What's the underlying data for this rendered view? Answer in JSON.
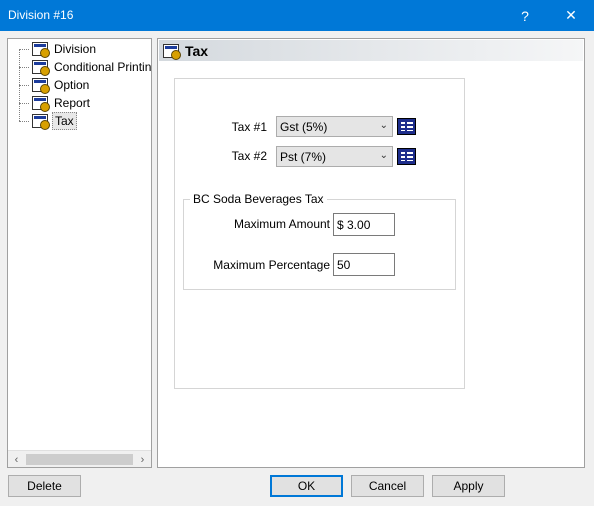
{
  "window": {
    "title": "Division #16",
    "help": "?",
    "close": "✕"
  },
  "tree": {
    "items": [
      {
        "label": "Division"
      },
      {
        "label": "Conditional Printin"
      },
      {
        "label": "Option"
      },
      {
        "label": "Report"
      },
      {
        "label": "Tax"
      }
    ],
    "selected": "Tax",
    "scroll_left": "‹",
    "scroll_right": "›"
  },
  "panel": {
    "title": "Tax",
    "tax1": {
      "label": "Tax #1",
      "value": "Gst (5%)"
    },
    "tax2": {
      "label": "Tax #2",
      "value": "Pst (7%)"
    },
    "group": {
      "title": "BC Soda Beverages Tax",
      "max_amount": {
        "label": "Maximum Amount",
        "value": "$ 3.00"
      },
      "max_percentage": {
        "label": "Maximum Percentage",
        "value": "50"
      }
    }
  },
  "buttons": {
    "delete": "Delete",
    "ok": "OK",
    "cancel": "Cancel",
    "apply": "Apply"
  },
  "colors": {
    "titlebar": "#0078d7",
    "list_button": "#1d2d8c"
  }
}
